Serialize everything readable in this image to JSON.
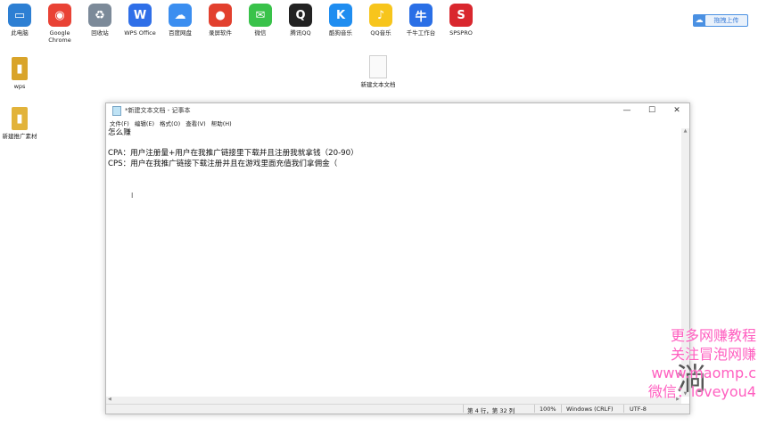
{
  "desktop": {
    "top_icons": [
      {
        "label": "此电脑",
        "glyph": "▭",
        "color": "#2d7fd3"
      },
      {
        "label": "Google Chrome",
        "glyph": "◉",
        "color": "#e94235"
      },
      {
        "label": "回收站",
        "glyph": "♻",
        "color": "#7c8a99"
      },
      {
        "label": "WPS Office",
        "glyph": "W",
        "color": "#2f6fe8"
      },
      {
        "label": "百度网盘",
        "glyph": "☁",
        "color": "#3b8ef0"
      },
      {
        "label": "录屏软件",
        "glyph": "●",
        "color": "#e2402e"
      },
      {
        "label": "微信",
        "glyph": "✉",
        "color": "#39c24a"
      },
      {
        "label": "腾讯QQ",
        "glyph": "Q",
        "color": "#222222"
      },
      {
        "label": "酷狗音乐",
        "glyph": "K",
        "color": "#1f8df0"
      },
      {
        "label": "QQ音乐",
        "glyph": "♪",
        "color": "#f7c51c"
      },
      {
        "label": "千牛工作台",
        "glyph": "牛",
        "color": "#2a6fe6"
      },
      {
        "label": "SPSPRO",
        "glyph": "S",
        "color": "#d9272e"
      }
    ],
    "left_icons": [
      {
        "label": "wps",
        "glyph": "▮",
        "color": "#d9a42a"
      },
      {
        "label": "新建推广素材",
        "glyph": "▮",
        "color": "#e2b33a"
      }
    ],
    "file_icon": {
      "label": "新建文本文档"
    },
    "upload_button": {
      "label": "拖拽上传",
      "icon": "cloud-icon"
    }
  },
  "notepad": {
    "title": "*新建文本文档 - 记事本",
    "window_controls": {
      "minimize": "—",
      "maximize": "☐",
      "close": "✕"
    },
    "menu": [
      "文件(F)",
      "编辑(E)",
      "格式(O)",
      "查看(V)",
      "帮助(H)"
    ],
    "lines": [
      "怎么赚",
      "",
      "CPA：用户注册量+用户在我推广链接里下载并且注册我就拿钱（20-90）",
      "CPS：用户在我推广链接下载注册并且在游戏里面充值我们拿佣金（"
    ],
    "caret": "I",
    "status": {
      "position": "第 4 行，第 32 列",
      "zoom": "100%",
      "line_ending": "Windows (CRLF)",
      "encoding": "UTF-8"
    }
  },
  "watermark": {
    "lines": [
      "更多网赚教程",
      "关注冒泡网赚",
      "www.maomp.c",
      "微信：loveyou4"
    ],
    "overlay_glyph": "淌"
  }
}
